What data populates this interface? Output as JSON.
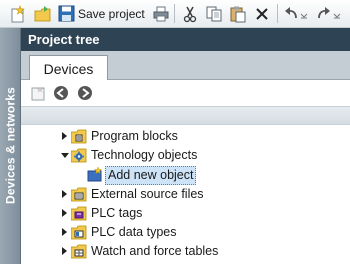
{
  "toolbar": {
    "save_label": "Save project",
    "icons": [
      "new-project-icon",
      "open-project-icon",
      "save-icon",
      "print-icon",
      "cut-icon",
      "copy-icon",
      "paste-icon",
      "delete-icon",
      "undo-icon",
      "redo-icon"
    ]
  },
  "sidebar": {
    "vertical_label": "Devices & networks"
  },
  "project_tree": {
    "title": "Project tree",
    "tabs": [
      {
        "label": "Devices",
        "active": true
      }
    ],
    "items": [
      {
        "label": "Program blocks",
        "expanded": false,
        "icon": "program-blocks-icon"
      },
      {
        "label": "Technology objects",
        "expanded": true,
        "icon": "technology-objects-icon"
      },
      {
        "label": "Add new object",
        "selected": true,
        "icon": "add-new-object-icon"
      },
      {
        "label": "External source files",
        "expanded": false,
        "icon": "external-source-files-icon"
      },
      {
        "label": "PLC tags",
        "expanded": false,
        "icon": "plc-tags-icon"
      },
      {
        "label": "PLC data types",
        "expanded": false,
        "icon": "plc-data-types-icon"
      },
      {
        "label": "Watch and force tables",
        "expanded": false,
        "icon": "watch-force-tables-icon"
      }
    ]
  },
  "colors": {
    "header_bg": "#2e4353",
    "sidebar_strip": "#8796a3",
    "tab_band": "#c4cdd3",
    "selection_bg": "#cde3f7",
    "folder_yellow": "#f2c94c"
  }
}
